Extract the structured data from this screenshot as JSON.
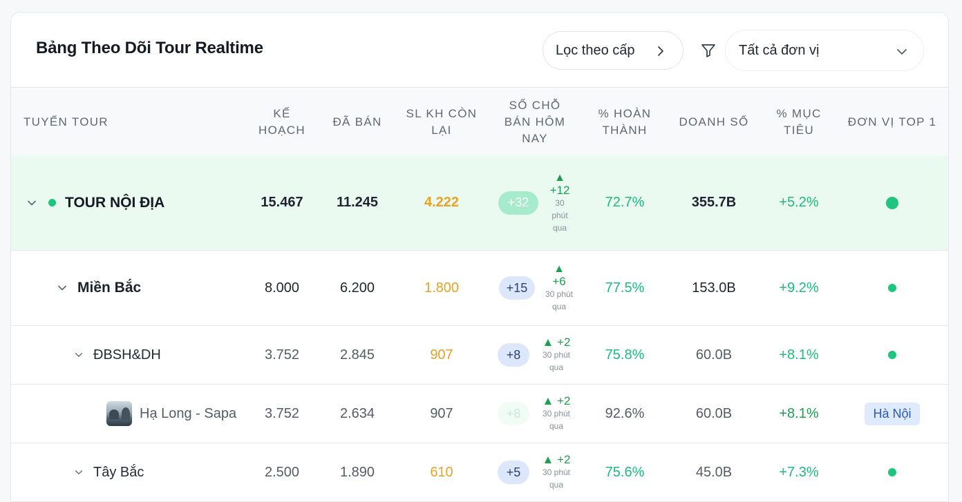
{
  "header": {
    "title": "Bảng Theo Dõi Tour Realtime",
    "filter_button_label": "Lọc theo cấp",
    "unit_select_value": "Tất cả đơn vị"
  },
  "columns": [
    "TUYẾN TOUR",
    "KẾ HOẠCH",
    "ĐÃ BÁN",
    "SL KH CÒN LẠI",
    "SỐ CHỖ BÁN HÔM NAY",
    "% HOÀN THÀNH",
    "DOANH SỐ",
    "% MỤC TIÊU",
    "ĐƠN VỊ TOP 1"
  ],
  "rows": [
    {
      "name": "TOUR NỘI ĐỊA",
      "plan": "15.467",
      "sold": "11.245",
      "remaining": "4.222",
      "today": "+32",
      "delta": "+12",
      "delta_note": "30 phút qua",
      "completion": "72.7%",
      "revenue": "355.7B",
      "target": "+5.2%"
    },
    {
      "name": "Miền Bắc",
      "plan": "8.000",
      "sold": "6.200",
      "remaining": "1.800",
      "today": "+15",
      "delta": "+6",
      "delta_note": "30 phút qua",
      "completion": "77.5%",
      "revenue": "153.0B",
      "target": "+9.2%"
    },
    {
      "name": "ĐBSH&DH",
      "plan": "3.752",
      "sold": "2.845",
      "remaining": "907",
      "today": "+8",
      "delta": "▲ +2",
      "delta_note": "30 phút qua",
      "completion": "75.8%",
      "revenue": "60.0B",
      "target": "+8.1%"
    },
    {
      "name": "Hạ Long - Sapa",
      "plan": "3.752",
      "sold": "2.634",
      "remaining": "907",
      "today": "+8",
      "delta": "▲ +2",
      "delta_note": "30 phút qua",
      "completion": "92.6%",
      "revenue": "60.0B",
      "target": "+8.1%",
      "top_unit": "Hà Nội"
    },
    {
      "name": "Tây Bắc",
      "plan": "2.500",
      "sold": "1.890",
      "remaining": "610",
      "today": "+5",
      "delta": "▲ +2",
      "delta_note": "30 phút qua",
      "completion": "75.6%",
      "revenue": "45.0B",
      "target": "+7.3%"
    }
  ],
  "icons": {
    "up_arrow": "▲",
    "filter": "filter-funnel-icon",
    "chevron_right": "chevron-right-icon",
    "chevron_down": "chevron-down-icon"
  },
  "colors": {
    "highlight_row": "#ebfaf0",
    "status_green": "#1fc47e",
    "remaining_orange": "#e8a224",
    "badge_blue": "#dfeafc"
  }
}
